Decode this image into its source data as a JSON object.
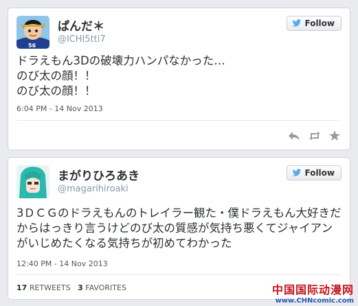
{
  "tweets": [
    {
      "name": "ぱんだ＊",
      "handle": "@lCHI5tti7",
      "follow_label": "Follow",
      "text_lines": [
        "ドラえもん3Dの破壊力ハンパなかった…",
        "のび太の顔！！",
        "のび太の顔！！"
      ],
      "timestamp": "6:04 PM - 14 Nov 2013",
      "avatar_icon": "anime-character-avatar-icon"
    },
    {
      "name": "まがりひろあき",
      "handle": "@magarihiroaki",
      "follow_label": "Follow",
      "text_lines": [
        "3ＤＣＧのドラえもんのトレイラー観た・僕ドラえもん大好きだ",
        "からはっきり言うけどのび太の質感が気持ち悪くてジャイアン",
        "がいじめたくなる気持ちが初めてわかった"
      ],
      "timestamp": "12:40 PM - 14 Nov 2013",
      "retweets_count": "17",
      "retweets_label": "RETWEETS",
      "favorites_count": "3",
      "favorites_label": "FAVORITES",
      "avatar_icon": "teal-hair-character-avatar-icon"
    }
  ],
  "watermark": {
    "line1": "中国国际动漫网",
    "line2": "www.CHNcomic.com"
  },
  "colors": {
    "text": "#292f33",
    "muted": "#8899a6",
    "twitter_blue": "#55acee"
  }
}
